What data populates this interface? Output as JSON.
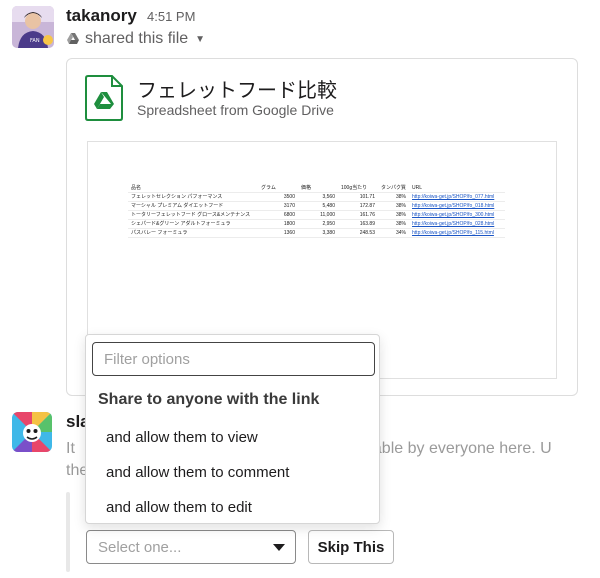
{
  "message": {
    "author": "takanory",
    "time": "4:51 PM",
    "action": "shared this file"
  },
  "file": {
    "title": "フェレットフード比較",
    "subtitle": "Spreadsheet from Google Drive",
    "sheet": {
      "headers": [
        "品名",
        "グラム",
        "価格",
        "100g当たり",
        "タンパク質",
        "URL"
      ],
      "rows": [
        [
          "フェレットセレクション パフォーマンス",
          "3500",
          "3,560",
          "101.71",
          "38%",
          "http://koiwa-get.jp/SHOP/fo_077.html"
        ],
        [
          "マーシャル プレミアム ダイエットフード",
          "3170",
          "5,480",
          "172.87",
          "38%",
          "http://koiwa-get.jp/SHOP/fo_018.html"
        ],
        [
          "トータリーフェレットフード グロース&メンテナンス",
          "6800",
          "11,000",
          "161.76",
          "38%",
          "http://koiwa-get.jp/SHOP/fo_300.html"
        ],
        [
          "シェパード&グリーン アダルトフォーミュラ",
          "1800",
          "2,950",
          "163.89",
          "38%",
          "http://koiwa-get.jp/SHOP/fo_028.html"
        ],
        [
          "パスバレー フォーミュラ",
          "1360",
          "3,380",
          "248.53",
          "34%",
          "http://koiwa-get.jp/SHOP/fo_115.html"
        ]
      ]
    }
  },
  "bot": {
    "name": "sla",
    "text_left": "It",
    "text_right": "viewable by everyone here. U",
    "text_line2": "the"
  },
  "dropdown": {
    "filter_placeholder": "Filter options",
    "group_title": "Share to anyone with the link",
    "options": [
      "and allow them to view",
      "and allow them to comment",
      "and allow them to edit"
    ]
  },
  "controls": {
    "select_placeholder": "Select one...",
    "skip_label": "Skip This"
  },
  "colors": {
    "drive_green": "#1e8e3e",
    "link_blue": "#1a55c5",
    "muted_text": "#616061"
  }
}
